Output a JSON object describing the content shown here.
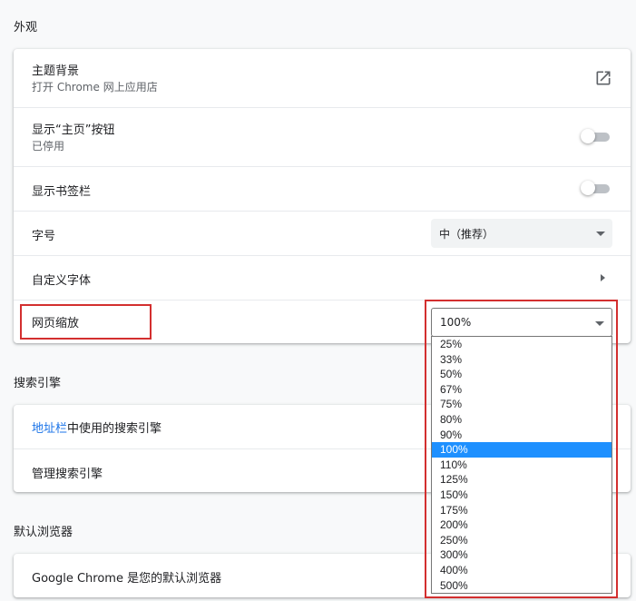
{
  "appearance": {
    "title": "外观",
    "theme": {
      "title": "主题背景",
      "subtitle": "打开 Chrome 网上应用店"
    },
    "home_button": {
      "title": "显示“主页”按钮",
      "subtitle": "已停用"
    },
    "bookmarks_bar": {
      "title": "显示书签栏"
    },
    "font_size": {
      "title": "字号",
      "value": "中（推荐）"
    },
    "custom_fonts": {
      "title": "自定义字体"
    },
    "page_zoom": {
      "title": "网页缩放",
      "value": "100%"
    }
  },
  "search_engine": {
    "title": "搜索引擎",
    "used_in_prefix": "地址栏",
    "used_in_suffix": "中使用的搜索引擎",
    "manage": "管理搜索引擎"
  },
  "default_browser": {
    "title": "默认浏览器",
    "status": "Google Chrome 是您的默认浏览器"
  },
  "zoom_options": [
    "25%",
    "33%",
    "50%",
    "67%",
    "75%",
    "80%",
    "90%",
    "100%",
    "110%",
    "125%",
    "150%",
    "175%",
    "200%",
    "250%",
    "300%",
    "400%",
    "500%"
  ],
  "zoom_selected_index": 7
}
